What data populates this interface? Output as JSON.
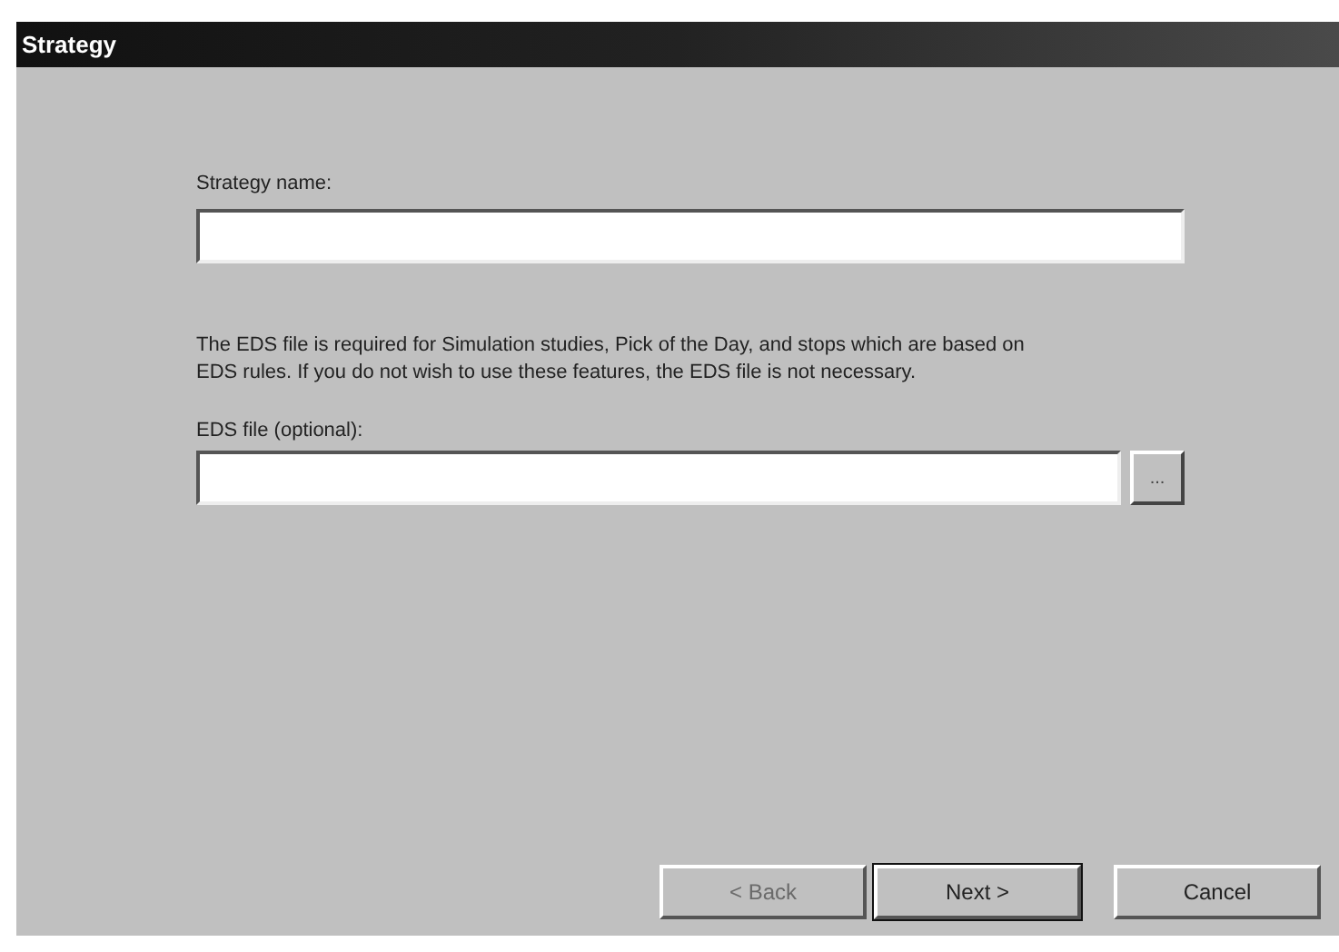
{
  "window": {
    "title": "Strategy"
  },
  "name_field": {
    "label": "Strategy name:"
  },
  "info": "The EDS file is required for Simulation studies, Pick of the Day, and stops which are based on EDS rules.  If you do not wish to use these features, the EDS file is not necessary.",
  "eds_field": {
    "label": "EDS file (optional):",
    "browse": "..."
  },
  "buttons": [
    {
      "label": "< Back",
      "disabled": true,
      "default": false
    },
    {
      "label": "Next >",
      "disabled": false,
      "default": true
    },
    {
      "label": "Cancel",
      "disabled": false,
      "default": false
    }
  ]
}
